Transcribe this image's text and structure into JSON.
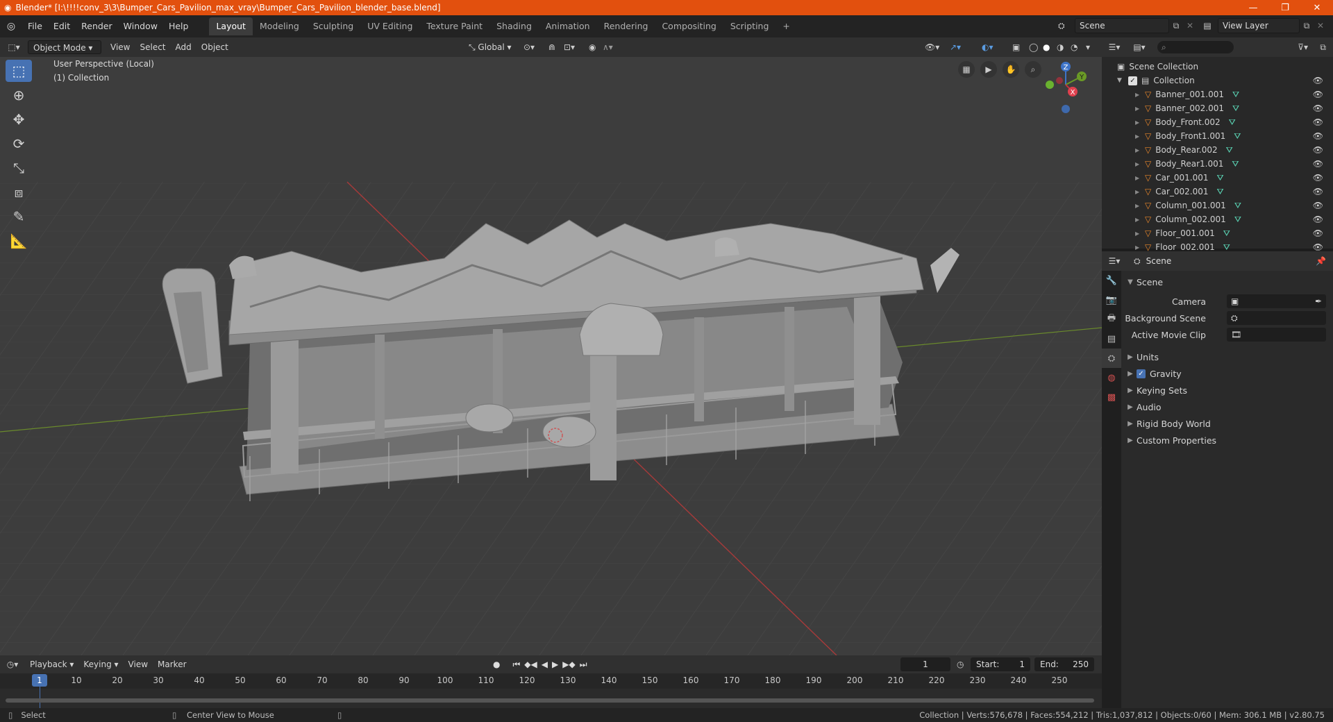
{
  "titlebar": {
    "title": "Blender* [I:\\!!!!conv_3\\3\\Bumper_Cars_Pavilion_max_vray\\Bumper_Cars_Pavilion_blender_base.blend]"
  },
  "menubar": {
    "items": [
      "File",
      "Edit",
      "Render",
      "Window",
      "Help"
    ],
    "workspaces": [
      "Layout",
      "Modeling",
      "Sculpting",
      "UV Editing",
      "Texture Paint",
      "Shading",
      "Animation",
      "Rendering",
      "Compositing",
      "Scripting"
    ],
    "add_tab": "+",
    "scene": "Scene",
    "view_layer": "View Layer"
  },
  "view3d_header": {
    "mode": "Object Mode",
    "menus": [
      "View",
      "Select",
      "Add",
      "Object"
    ],
    "transform_orientation": "Global"
  },
  "viewport": {
    "perspective": "User Perspective (Local)",
    "collection": "(1) Collection",
    "gizmo": {
      "z": "Z",
      "y": "Y",
      "x": "X"
    }
  },
  "toolbar": {
    "tools": [
      "select-box",
      "cursor",
      "move",
      "rotate",
      "scale",
      "transform",
      "annotate",
      "measure"
    ]
  },
  "outliner": {
    "search_placeholder": "",
    "scene_collection": "Scene Collection",
    "collection": "Collection",
    "items": [
      "Banner_001.001",
      "Banner_002.001",
      "Body_Front.002",
      "Body_Front1.001",
      "Body_Rear.002",
      "Body_Rear1.001",
      "Car_001.001",
      "Car_002.001",
      "Column_001.001",
      "Column_002.001",
      "Floor_001.001",
      "Floor_002.001"
    ]
  },
  "properties": {
    "header": "Scene",
    "section": "Scene",
    "fields": [
      {
        "label": "Camera",
        "value": ""
      },
      {
        "label": "Background Scene",
        "value": ""
      },
      {
        "label": "Active Movie Clip",
        "value": ""
      }
    ],
    "subsections": [
      "Units",
      "Gravity",
      "Keying Sets",
      "Audio",
      "Rigid Body World",
      "Custom Properties"
    ],
    "gravity_checked": true
  },
  "timeline": {
    "menus": [
      "Playback",
      "Keying",
      "View",
      "Marker"
    ],
    "current_frame": "1",
    "start_label": "Start:",
    "start": "1",
    "end_label": "End:",
    "end": "250",
    "ticks": [
      "1",
      "10",
      "20",
      "30",
      "40",
      "50",
      "60",
      "70",
      "80",
      "90",
      "100",
      "110",
      "120",
      "130",
      "140",
      "150",
      "160",
      "170",
      "180",
      "190",
      "200",
      "210",
      "220",
      "230",
      "240",
      "250"
    ]
  },
  "statusbar": {
    "left_action": "Select",
    "mid_action": "Center View to Mouse",
    "stats": "Collection | Verts:576,678 | Faces:554,212 | Tris:1,037,812 | Objects:0/60 | Mem: 306.1 MB | v2.80.75"
  }
}
